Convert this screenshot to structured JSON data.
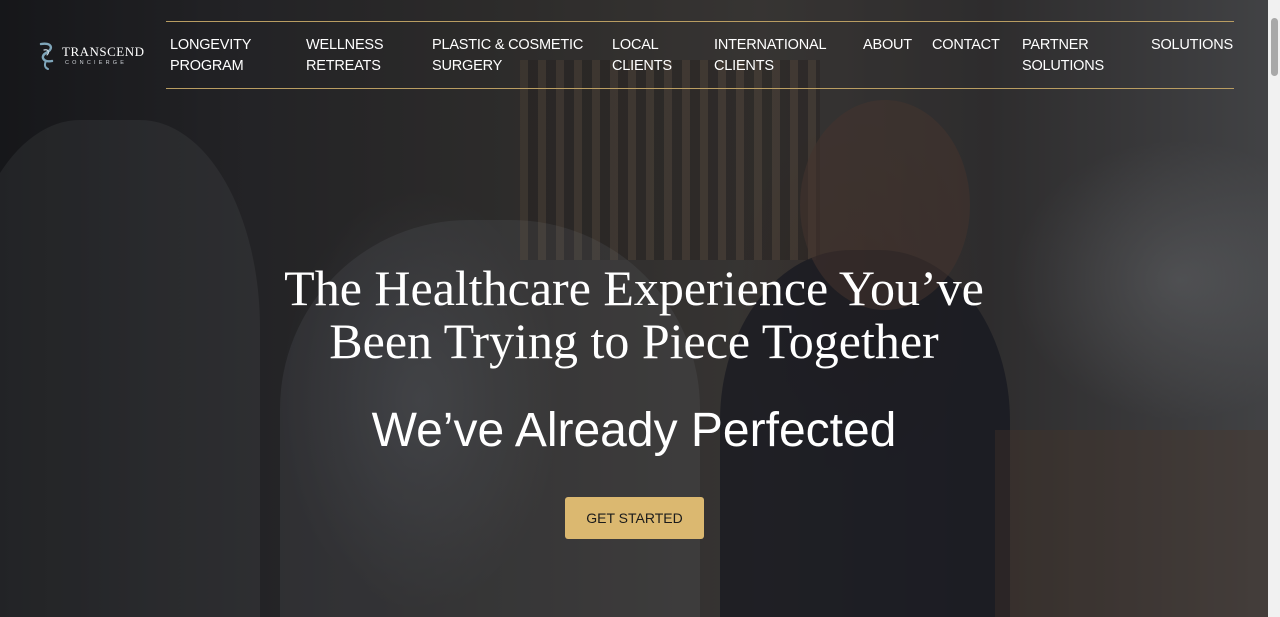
{
  "brand": {
    "name": "TRANSCEND",
    "tagline": "CONCIERGE",
    "accent_color": "#b99d62",
    "logo_icon": "transcend-wave-icon"
  },
  "nav": {
    "items": [
      {
        "line1": "LONGEVITY",
        "line2": "PROGRAM"
      },
      {
        "line1": "WELLNESS",
        "line2": "RETREATS"
      },
      {
        "line1": "PLASTIC & COSMETIC",
        "line2": "SURGERY"
      },
      {
        "line1": "LOCAL",
        "line2": "CLIENTS"
      },
      {
        "line1": "INTERNATIONAL",
        "line2": "CLIENTS"
      },
      {
        "line1": "ABOUT",
        "line2": ""
      },
      {
        "line1": "CONTACT",
        "line2": ""
      },
      {
        "line1": "PARTNER",
        "line2": "SOLUTIONS"
      },
      {
        "line1": "SOLUTIONS",
        "line2": ""
      }
    ]
  },
  "hero": {
    "headline_line1": "The Healthcare Experience You’ve",
    "headline_line2": "Been Trying to Piece Together",
    "subheadline": "We’ve Already Perfected",
    "cta_label": "GET STARTED",
    "cta_color": "#dbb870"
  }
}
